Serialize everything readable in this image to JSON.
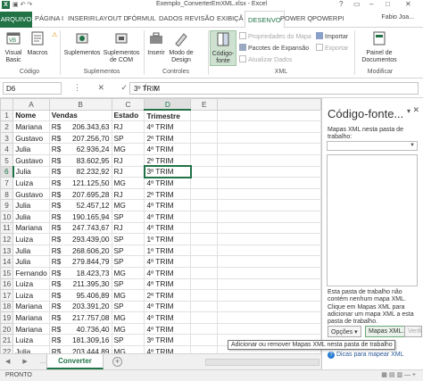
{
  "window": {
    "title": "Exemplo_ConverterEmXML.xlsx - Excel",
    "user": "Fabio Joa...",
    "controls": [
      "?",
      "▭",
      "–",
      "□",
      "✕"
    ]
  },
  "tabs": {
    "file": "ARQUIVO",
    "items": [
      "PÁGINA I",
      "INSERIR",
      "LAYOUT D",
      "FÓRMUL",
      "DADOS",
      "REVISÃO",
      "EXIBIÇÃ",
      "DESENVO",
      "POWER Q",
      "POWERPI"
    ]
  },
  "ribbon": {
    "codigo": {
      "visual_basic": "Visual\nBasic",
      "macros": "Macros",
      "warning": "⚠",
      "label": "Código"
    },
    "suplementos": {
      "suplementos": "Suplementos",
      "suplementos_com": "Suplementos\nde COM",
      "label": "Suplementos"
    },
    "controles": {
      "inserir": "Inserir",
      "modo_design": "Modo de\nDesign",
      "label": "Controles"
    },
    "xml": {
      "codigo_fonte": "Código-\nfonte",
      "propriedades": "Propriedades do Mapa",
      "pacotes": "Pacotes de Expansão",
      "atualizar": "Atualizar Dados",
      "importar": "Importar",
      "exportar": "Exportar",
      "label": "XML"
    },
    "modificar": {
      "painel": "Painel de\nDocumentos",
      "label": "Modificar"
    }
  },
  "formula_bar": {
    "name_box": "D6",
    "value": "3º TRIM",
    "icons": "⋮ ✕ ✓ fx"
  },
  "sheet": {
    "columns": [
      "A",
      "B",
      "C",
      "D",
      "E"
    ],
    "active_cell": "D6",
    "header_row": [
      "Nome",
      "Vendas",
      "Estado",
      "Trimestre",
      ""
    ],
    "rows": [
      [
        "Mariana",
        "206.343,63",
        "RJ",
        "4º TRIM"
      ],
      [
        "Gustavo",
        "207.256,70",
        "SP",
        "2º TRIM"
      ],
      [
        "Julia",
        "62.936,24",
        "MG",
        "4º TRIM"
      ],
      [
        "Gustavo",
        "83.602,95",
        "RJ",
        "2º TRIM"
      ],
      [
        "Julia",
        "82.232,92",
        "RJ",
        "3º TRIM"
      ],
      [
        "Luiza",
        "121.125,50",
        "MG",
        "4º TRIM"
      ],
      [
        "Gustavo",
        "207.695,28",
        "RJ",
        "2º TRIM"
      ],
      [
        "Julia",
        "52.457,12",
        "MG",
        "4º TRIM"
      ],
      [
        "Julia",
        "190.165,94",
        "SP",
        "4º TRIM"
      ],
      [
        "Mariana",
        "247.743,67",
        "RJ",
        "4º TRIM"
      ],
      [
        "Luiza",
        "293.439,00",
        "SP",
        "1º TRIM"
      ],
      [
        "Julia",
        "268.606,20",
        "SP",
        "1º TRIM"
      ],
      [
        "Julia",
        "279.844,79",
        "SP",
        "4º TRIM"
      ],
      [
        "Fernando",
        "18.423,73",
        "MG",
        "4º TRIM"
      ],
      [
        "Luiza",
        "211.395,30",
        "SP",
        "4º TRIM"
      ],
      [
        "Luiza",
        "95.406,89",
        "MG",
        "2º TRIM"
      ],
      [
        "Mariana",
        "203.391,20",
        "SP",
        "4º TRIM"
      ],
      [
        "Mariana",
        "217.757,08",
        "MG",
        "4º TRIM"
      ],
      [
        "Mariana",
        "40.736,40",
        "MG",
        "4º TRIM"
      ],
      [
        "Luiza",
        "181.309,16",
        "SP",
        "3º TRIM"
      ],
      [
        "Julia",
        "203.444,89",
        "MG",
        "4º TRIM"
      ]
    ],
    "currency": "R$",
    "row_numbers": [
      "1",
      "2",
      "3",
      "4",
      "5",
      "6",
      "7",
      "8",
      "9",
      "10",
      "11",
      "12",
      "13",
      "14",
      "15",
      "16",
      "17",
      "18",
      "19",
      "20",
      "21",
      "22"
    ]
  },
  "sheet_tabs": {
    "active": "Converter",
    "add": "+"
  },
  "status": {
    "text": "PRONTO",
    "icons": "▦ ▤ ▥  —  +"
  },
  "task_pane": {
    "title": "Código-fonte...",
    "close": "✕",
    "dropdown": "▾",
    "maps_label": "Mapas XML nesta pasta de trabalho:",
    "description": "Esta pasta de trabalho não contém nenhum mapa XML. Clique em Mapas XML para adicionar um mapa XML a esta pasta de trabalho.",
    "options_button": "Opções ▾",
    "maps_button": "Mapas XML...",
    "verify_button": "Verificação...",
    "help_link": "Dicas para mapear XML"
  },
  "tooltip": "Adicionar ou remover Mapas XML nesta pasta de trabalho",
  "colors": {
    "accent": "#217346",
    "link": "#2b5797"
  }
}
